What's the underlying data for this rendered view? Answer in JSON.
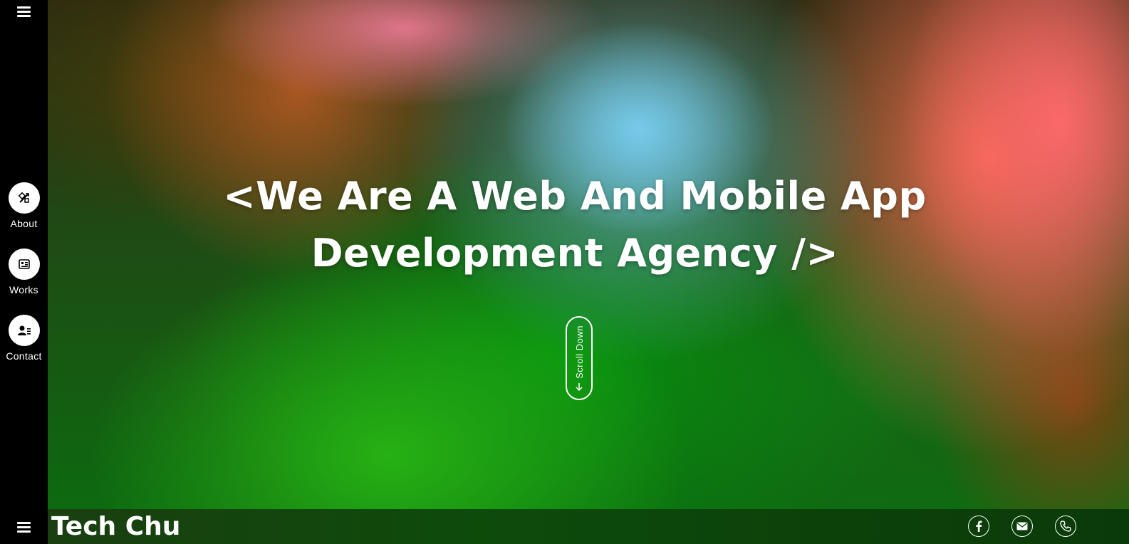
{
  "nav": {
    "items": [
      {
        "label": "About",
        "icon": "design-tools-icon"
      },
      {
        "label": "Works",
        "icon": "portfolio-icon"
      },
      {
        "label": "Contact",
        "icon": "contact-card-icon"
      }
    ]
  },
  "hero": {
    "title_line1": "<We Are A Web And Mobile App",
    "title_line2": "Development Agency />",
    "scroll_label": "Scroll Down"
  },
  "footer": {
    "brand": "Tech Chu",
    "social": [
      "facebook-icon",
      "email-icon",
      "phone-icon"
    ]
  },
  "colors": {
    "sidebar": "#000000",
    "text": "#ffffff",
    "footer_bar": "#0d4b0b"
  }
}
